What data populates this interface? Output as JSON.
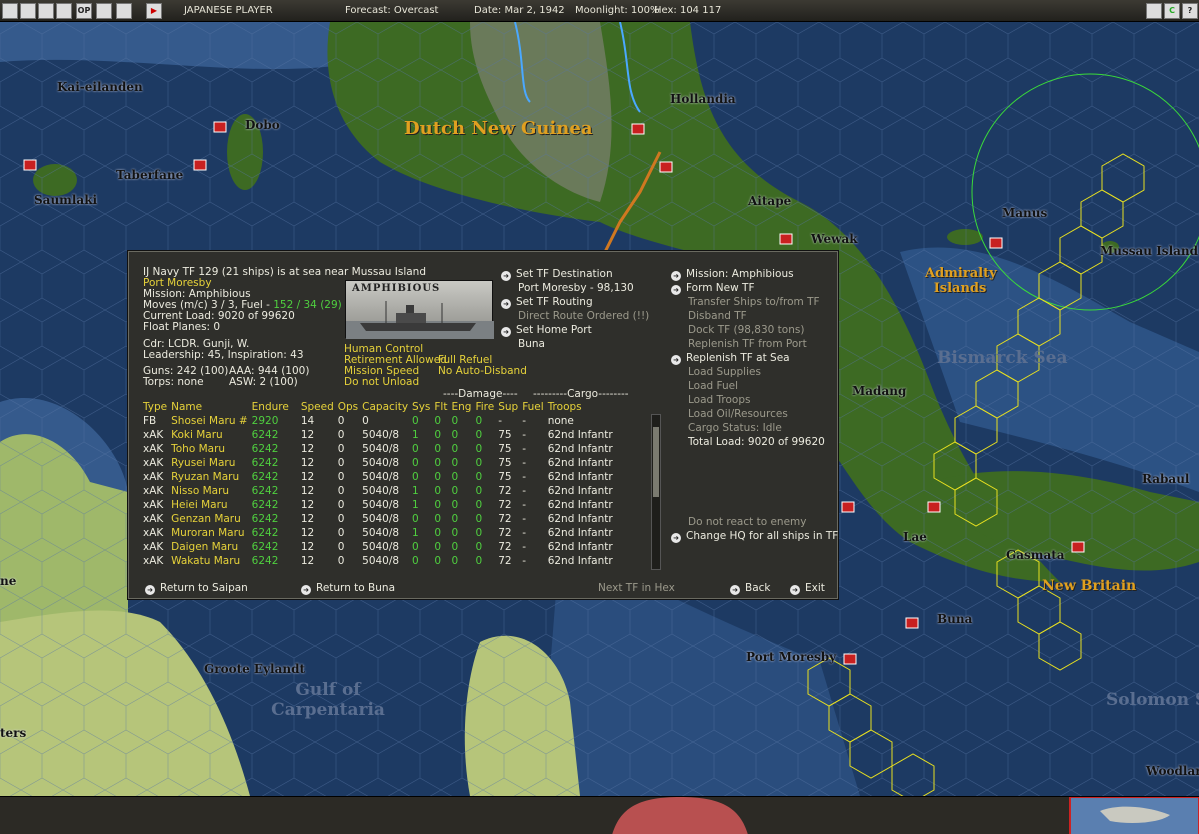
{
  "topbar": {
    "buttons": [
      "",
      "",
      "",
      "",
      "OP",
      "",
      "",
      "▶"
    ],
    "side": "JAPANESE PLAYER",
    "forecast": "Forecast: Overcast",
    "date": "Date: Mar 2, 1942",
    "moonlight": "Moonlight: 100%",
    "hex": "Hex: 104 117",
    "right_buttons": [
      "",
      "C",
      "?"
    ]
  },
  "map": {
    "places": [
      {
        "name": "Kai-eilanden"
      },
      {
        "name": "Dobo"
      },
      {
        "name": "Taberfane"
      },
      {
        "name": "Saumlaki"
      },
      {
        "name": "Hollandia"
      },
      {
        "name": "Aitape"
      },
      {
        "name": "Wewak"
      },
      {
        "name": "Manus"
      },
      {
        "name": "Mussau Island"
      },
      {
        "name": "Madang"
      },
      {
        "name": "Rabaul"
      },
      {
        "name": "Lae"
      },
      {
        "name": "Gasmata"
      },
      {
        "name": "Buna"
      },
      {
        "name": "Port Moresby"
      },
      {
        "name": "Groote Eylandt"
      },
      {
        "name": "Woodlark"
      },
      {
        "name": "ne"
      },
      {
        "name": "ters"
      }
    ],
    "regions": [
      "Dutch New Guinea",
      "Admiralty Islands",
      "New Britain"
    ],
    "seas": [
      "Bismarck Sea",
      "Gulf of Carpentaria",
      "Solomon S"
    ]
  },
  "panel": {
    "tf_title": "IJ Navy TF 129 (21 ships) is at sea near Mussau Island",
    "destination": "Port Moresby",
    "mission": "Mission: Amphibious",
    "moves_prefix": "Moves (m/c) 3 / 3, Fuel - ",
    "moves_fuel": "152 / 34 (29)",
    "current_load": "Current Load: 9020 of 99620",
    "float_planes": "Float Planes: 0",
    "cdr": "Cdr: LCDR. Gunji, W.",
    "leadership": "Leadership: 45, Inspiration: 43",
    "guns": "Guns: 242 (100)",
    "aaa": "AAA: 944 (100)",
    "torps": "Torps: none",
    "asw": "ASW: 2 (100)",
    "image_label": "AMPHIBIOUS",
    "human_control": "Human Control",
    "retirement": "Retirement Allowed",
    "full_refuel": "Full Refuel",
    "mission_speed": "Mission Speed",
    "no_auto": "No Auto-Disband",
    "do_not_unload": "Do not Unload",
    "mid": {
      "set_dest": "Set TF Destination",
      "dest_value": "Port Moresby - 98,130",
      "set_routing": "Set TF Routing",
      "direct": "Direct Route Ordered (!!)",
      "set_home": "Set Home Port",
      "home_value": "Buna"
    },
    "right": {
      "mission": "Mission: Amphibious",
      "form_new": "Form New TF",
      "transfer": "Transfer Ships to/from TF",
      "disband": "Disband TF",
      "dock": "Dock TF (98,830 tons)",
      "replenish_port": "Replenish TF from Port",
      "replenish_sea": "Replenish TF at Sea",
      "load_supplies": "Load Supplies",
      "load_fuel": "Load Fuel",
      "load_troops": "Load Troops",
      "load_oil": "Load Oil/Resources",
      "cargo_status": "Cargo Status: Idle",
      "total_load": "Total Load: 9020 of 99620",
      "no_react": "Do not react to enemy",
      "change_hq": "Change HQ for all ships in TF"
    },
    "group_damage": "----Damage----",
    "group_cargo": "---------Cargo--------",
    "columns": [
      "Type",
      "Name",
      "Endure",
      "Speed",
      "Ops",
      "Capacity",
      "Sys",
      "Flt",
      "Eng",
      "Fire",
      "Sup",
      "Fuel",
      "Troops"
    ],
    "ships": [
      [
        "FB",
        "Shosei Maru #",
        "2920",
        "14",
        "0",
        "0",
        "0",
        "0",
        "0",
        "0",
        "-",
        "-",
        "none"
      ],
      [
        "xAK",
        "Koki Maru",
        "6242",
        "12",
        "0",
        "5040/8",
        "1",
        "0",
        "0",
        "0",
        "75",
        "-",
        "62nd Infantr"
      ],
      [
        "xAK",
        "Toho Maru",
        "6242",
        "12",
        "0",
        "5040/8",
        "0",
        "0",
        "0",
        "0",
        "75",
        "-",
        "62nd Infantr"
      ],
      [
        "xAK",
        "Ryusei Maru",
        "6242",
        "12",
        "0",
        "5040/8",
        "0",
        "0",
        "0",
        "0",
        "75",
        "-",
        "62nd Infantr"
      ],
      [
        "xAK",
        "Ryuzan Maru",
        "6242",
        "12",
        "0",
        "5040/8",
        "0",
        "0",
        "0",
        "0",
        "75",
        "-",
        "62nd Infantr"
      ],
      [
        "xAK",
        "Nisso Maru",
        "6242",
        "12",
        "0",
        "5040/8",
        "1",
        "0",
        "0",
        "0",
        "72",
        "-",
        "62nd Infantr"
      ],
      [
        "xAK",
        "Heiei Maru",
        "6242",
        "12",
        "0",
        "5040/8",
        "1",
        "0",
        "0",
        "0",
        "72",
        "-",
        "62nd Infantr"
      ],
      [
        "xAK",
        "Genzan Maru",
        "6242",
        "12",
        "0",
        "5040/8",
        "0",
        "0",
        "0",
        "0",
        "72",
        "-",
        "62nd Infantr"
      ],
      [
        "xAK",
        "Muroran Maru",
        "6242",
        "12",
        "0",
        "5040/8",
        "1",
        "0",
        "0",
        "0",
        "72",
        "-",
        "62nd Infantr"
      ],
      [
        "xAK",
        "Daigen Maru",
        "6242",
        "12",
        "0",
        "5040/8",
        "0",
        "0",
        "0",
        "0",
        "72",
        "-",
        "62nd Infantr"
      ],
      [
        "xAK",
        "Wakatu Maru",
        "6242",
        "12",
        "0",
        "5040/8",
        "0",
        "0",
        "0",
        "0",
        "72",
        "-",
        "62nd Infantr"
      ]
    ],
    "footer": {
      "return_saipan": "Return to Saipan",
      "return_buna": "Return to Buna",
      "next_tf": "Next TF in Hex",
      "back": "Back",
      "exit": "Exit"
    }
  },
  "colors": {
    "sea": "#1d3a63",
    "shallow": "#3f6a9a",
    "jungle": "#3d6a23",
    "land": "#9fb86a",
    "hex_yellow": "#e8e020",
    "circle_green": "#3adb3a",
    "panel_bg": "#2f2f2b",
    "highlight_yellow": "#e6d23a",
    "highlight_green": "#4fcf3f"
  }
}
